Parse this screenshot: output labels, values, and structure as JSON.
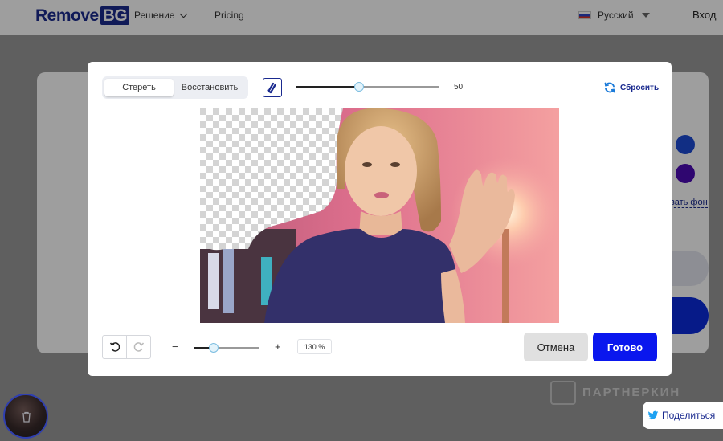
{
  "nav": {
    "logo_main": "Remove",
    "logo_box": "BG",
    "solution": "Решение",
    "pricing": "Pricing",
    "language": "Русский",
    "login": "Вход"
  },
  "background_page": {
    "change_bg_link": "вать фон"
  },
  "watermark": "ПАРТНЕРКИН",
  "share": {
    "label": "Поделиться"
  },
  "editor": {
    "tabs": {
      "erase": "Стереть",
      "restore": "Восстановить",
      "selected": "erase"
    },
    "brush_size": "50",
    "brush_level": 0.44,
    "reset_label": "Сбросить",
    "zoom_minus": "−",
    "zoom_plus": "+",
    "zoom_value": "130 %",
    "zoom_level": 0.3,
    "cancel_label": "Отмена",
    "done_label": "Готово"
  },
  "colors": {
    "brand": "#1a2a8f",
    "primary_button": "#0a17ee",
    "swatch_blue": "#1c4bd6",
    "swatch_purple": "#4c0ab5"
  },
  "icons": [
    "chevron-down-icon",
    "flag-icon",
    "brush-icon",
    "refresh-icon",
    "undo-icon",
    "redo-icon",
    "twitter-icon",
    "trash-icon"
  ]
}
